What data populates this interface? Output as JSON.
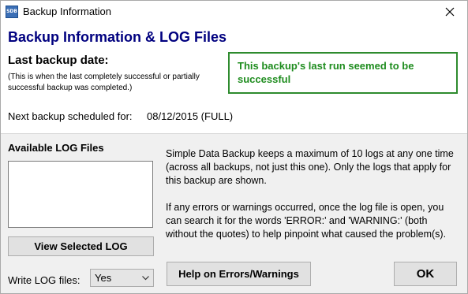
{
  "window": {
    "icon_text": "SDB",
    "title": "Backup Information",
    "close_icon": "close-icon"
  },
  "header": {
    "main_title": "Backup Information & LOG Files",
    "last_backup_label": "Last backup date:",
    "last_backup_note": "(This is when the last completely successful or partially successful backup was completed.)",
    "status_message": "This backup's last run seemed to be successful",
    "next_backup_label": "Next backup scheduled for:",
    "next_backup_value": "08/12/2015  (FULL)"
  },
  "logs": {
    "title": "Available LOG Files",
    "items": [],
    "view_button": "View Selected LOG",
    "write_label": "Write LOG files:",
    "write_value": "Yes"
  },
  "info": {
    "paragraph1": "Simple Data Backup keeps a maximum of 10 logs at any one time (across all backups, not just this one). Only the logs that apply for this backup are shown.",
    "paragraph2": "If any errors or warnings occurred, once the log file is open, you can search it for the words 'ERROR:' and 'WARNING:' (both without the quotes) to help pinpoint what caused the problem(s)."
  },
  "buttons": {
    "help": "Help on Errors/Warnings",
    "ok": "OK"
  },
  "colors": {
    "title_blue": "#00007f",
    "status_green": "#1e8c1e"
  }
}
